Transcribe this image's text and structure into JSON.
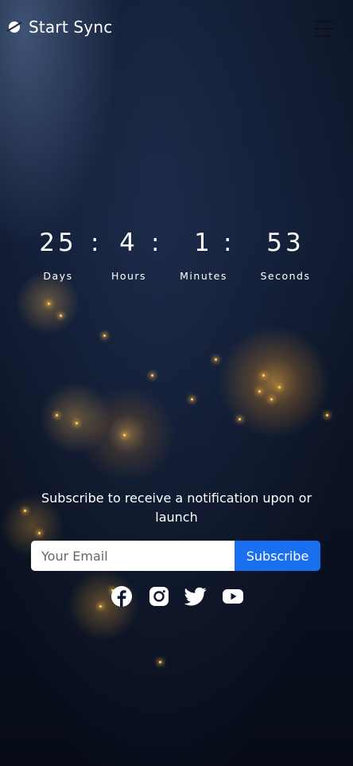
{
  "brand": {
    "name": "Start Sync",
    "icon": "planet-icon"
  },
  "menu": {
    "icon": "hamburger-icon"
  },
  "countdown": {
    "days": "25",
    "hours": "4",
    "minutes": "1",
    "seconds": "53",
    "separator": ":",
    "labels": {
      "days": "Days",
      "hours": "Hours",
      "minutes": "Minutes",
      "seconds": "Seconds"
    }
  },
  "subscribe": {
    "message": "Subscribe to receive a notification upon or launch",
    "email_placeholder": "Your Email",
    "email_value": "",
    "button_label": "Subscribe",
    "button_color": "#1a6ff0"
  },
  "social": [
    {
      "icon": "facebook-icon"
    },
    {
      "icon": "instagram-icon"
    },
    {
      "icon": "twitter-icon"
    },
    {
      "icon": "youtube-icon"
    }
  ]
}
